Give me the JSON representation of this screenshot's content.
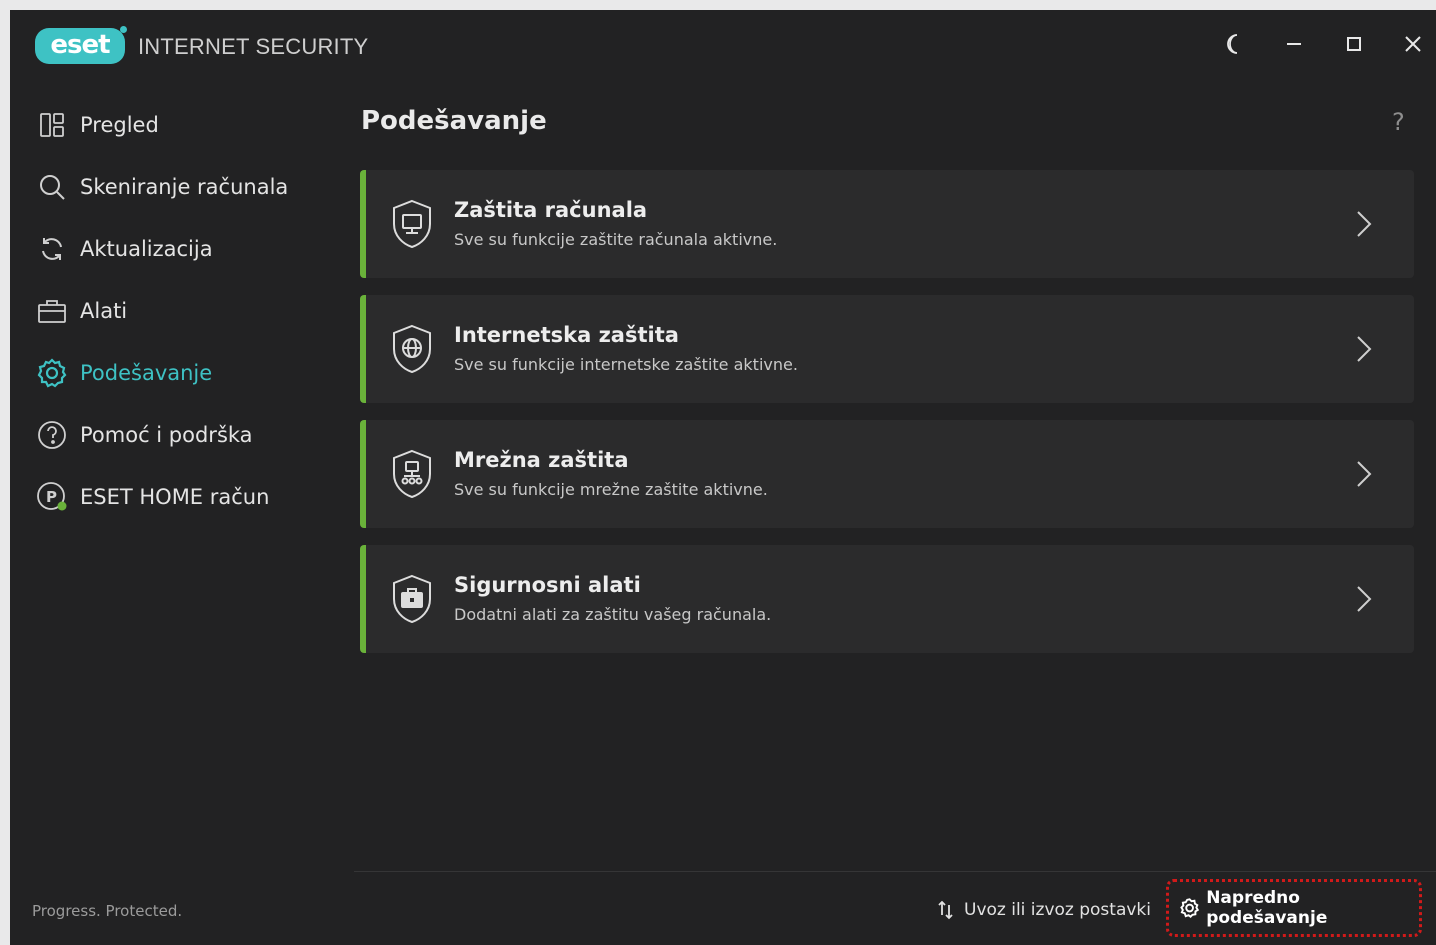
{
  "app": {
    "logo_text": "eset",
    "product_name": "INTERNET SECURITY",
    "accent_color": "#3ec2c4",
    "card_accent_color": "#6ab23a"
  },
  "window_controls": {
    "theme_icon": "moon-icon",
    "minimize_icon": "minimize-icon",
    "maximize_icon": "maximize-icon",
    "close_icon": "close-icon"
  },
  "sidebar": {
    "items": [
      {
        "label": "Pregled",
        "icon": "overview-icon",
        "active": false
      },
      {
        "label": "Skeniranje računala",
        "icon": "search-icon",
        "active": false
      },
      {
        "label": "Aktualizacija",
        "icon": "refresh-icon",
        "active": false
      },
      {
        "label": "Alati",
        "icon": "briefcase-icon",
        "active": false
      },
      {
        "label": "Podešavanje",
        "icon": "gear-icon",
        "active": true
      },
      {
        "label": "Pomoć i podrška",
        "icon": "question-icon",
        "active": false
      },
      {
        "label": "ESET HOME račun",
        "icon": "account-icon",
        "active": false
      }
    ],
    "tagline": "Progress. Protected."
  },
  "main": {
    "title": "Podešavanje",
    "help_label": "?",
    "cards": [
      {
        "title": "Zaštita računala",
        "subtitle": "Sve su funkcije zaštite računala aktivne.",
        "icon": "computer-shield-icon"
      },
      {
        "title": "Internetska zaštita",
        "subtitle": "Sve su funkcije internetske zaštite aktivne.",
        "icon": "globe-shield-icon"
      },
      {
        "title": "Mrežna zaštita",
        "subtitle": "Sve su funkcije mrežne zaštite aktivne.",
        "icon": "network-shield-icon"
      },
      {
        "title": "Sigurnosni alati",
        "subtitle": "Dodatni alati za zaštitu vašeg računala.",
        "icon": "toolbox-shield-icon"
      }
    ]
  },
  "footer": {
    "import_export_label": "Uvoz ili izvoz postavki",
    "advanced_label": "Napredno podešavanje"
  }
}
